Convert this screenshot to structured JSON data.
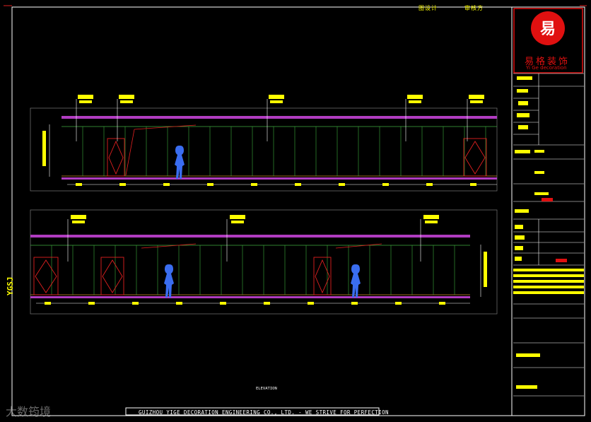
{
  "header": {
    "label_left": "图设计",
    "label_right": "审核方"
  },
  "logo": {
    "brand_cn": "易格装饰",
    "brand_en": "Yi Ge decoration",
    "mark_color": "#e01010"
  },
  "drawing": {
    "view_label": "ELEVATION",
    "footer": "GUIZHOU YIGE DECORATION ENGINEERING CO., LTD. - WE STRIVE FOR PERFECTION",
    "side_label": "YGSJ"
  },
  "watermark": {
    "text": "大数筠境"
  },
  "colors": {
    "background": "#000000",
    "frame": "#ffffff",
    "annotation": "#ffff00",
    "ceiling_band": "#b03cc0",
    "wall_lines": "#3fae3f",
    "door_lines": "#e02020",
    "dim_lines": "#d08a2a",
    "figure": "#3a6df0"
  }
}
